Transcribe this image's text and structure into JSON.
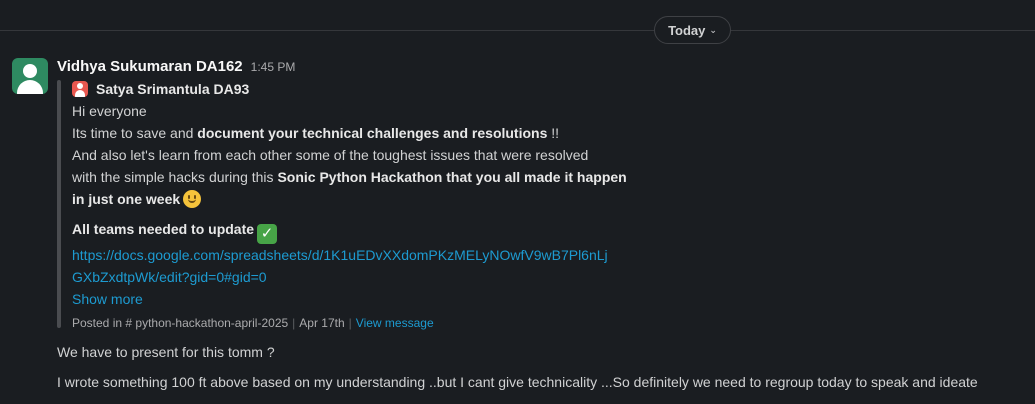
{
  "divider": {
    "label": "Today"
  },
  "message": {
    "author": "Vidhya Sukumaran DA162",
    "time": "1:45 PM",
    "shared": {
      "author": "Satya Srimantula DA93",
      "line1": "Hi everyone",
      "line2_a": "Its time to save and ",
      "line2_b": "document your technical challenges and resolutions",
      "line2_c": " !!",
      "line3": "And also let's learn from each other some of the toughest issues that were resolved",
      "line4_a": "with the simple hacks during this ",
      "line4_b": "Sonic Python Hackathon that you all made it happen",
      "line5": "in just one week",
      "teams_line": "All teams needed to update",
      "link_line1": "https://docs.google.com/spreadsheets/d/1K1uEDvXXdomPKzMELyNOwfV9wB7Pl6nLj",
      "link_line2": "GXbZxdtpWk/edit?gid=0#gid=0",
      "show_more": "Show more",
      "posted_in": "Posted in",
      "channel": "# python-hackathon-april-2025",
      "date": "Apr 17th",
      "view_message": "View message"
    }
  },
  "replies": [
    "We have to present for this tomm ?",
    "I wrote something 100 ft above based on my understanding ..but I cant give technicality ...So definitely we need to regroup today to speak and ideate"
  ],
  "colors": {
    "background": "#1a1d21",
    "link": "#1d9bd1",
    "avatar": "#2e8a61",
    "quote_bar": "#4a4c50"
  }
}
